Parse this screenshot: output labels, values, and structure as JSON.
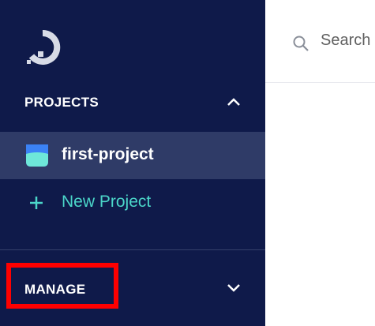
{
  "sidebar": {
    "logo_icon": "digitalocean-logo-icon",
    "projects_title": "PROJECTS",
    "projects_chevron_icon": "chevron-up-icon",
    "project": {
      "label": "first-project",
      "icon": "project-icon"
    },
    "new_project": {
      "label": "New Project",
      "icon": "plus-icon"
    },
    "manage_title": "MANAGE",
    "manage_chevron_icon": "chevron-down-icon"
  },
  "topbar": {
    "search_label": "Search",
    "search_icon": "search-icon"
  },
  "colors": {
    "sidebar_bg": "#0f1a4a",
    "selected_bg": "#2f3b67",
    "accent_teal": "#4bd6c9",
    "highlight_red": "#ff0000"
  }
}
